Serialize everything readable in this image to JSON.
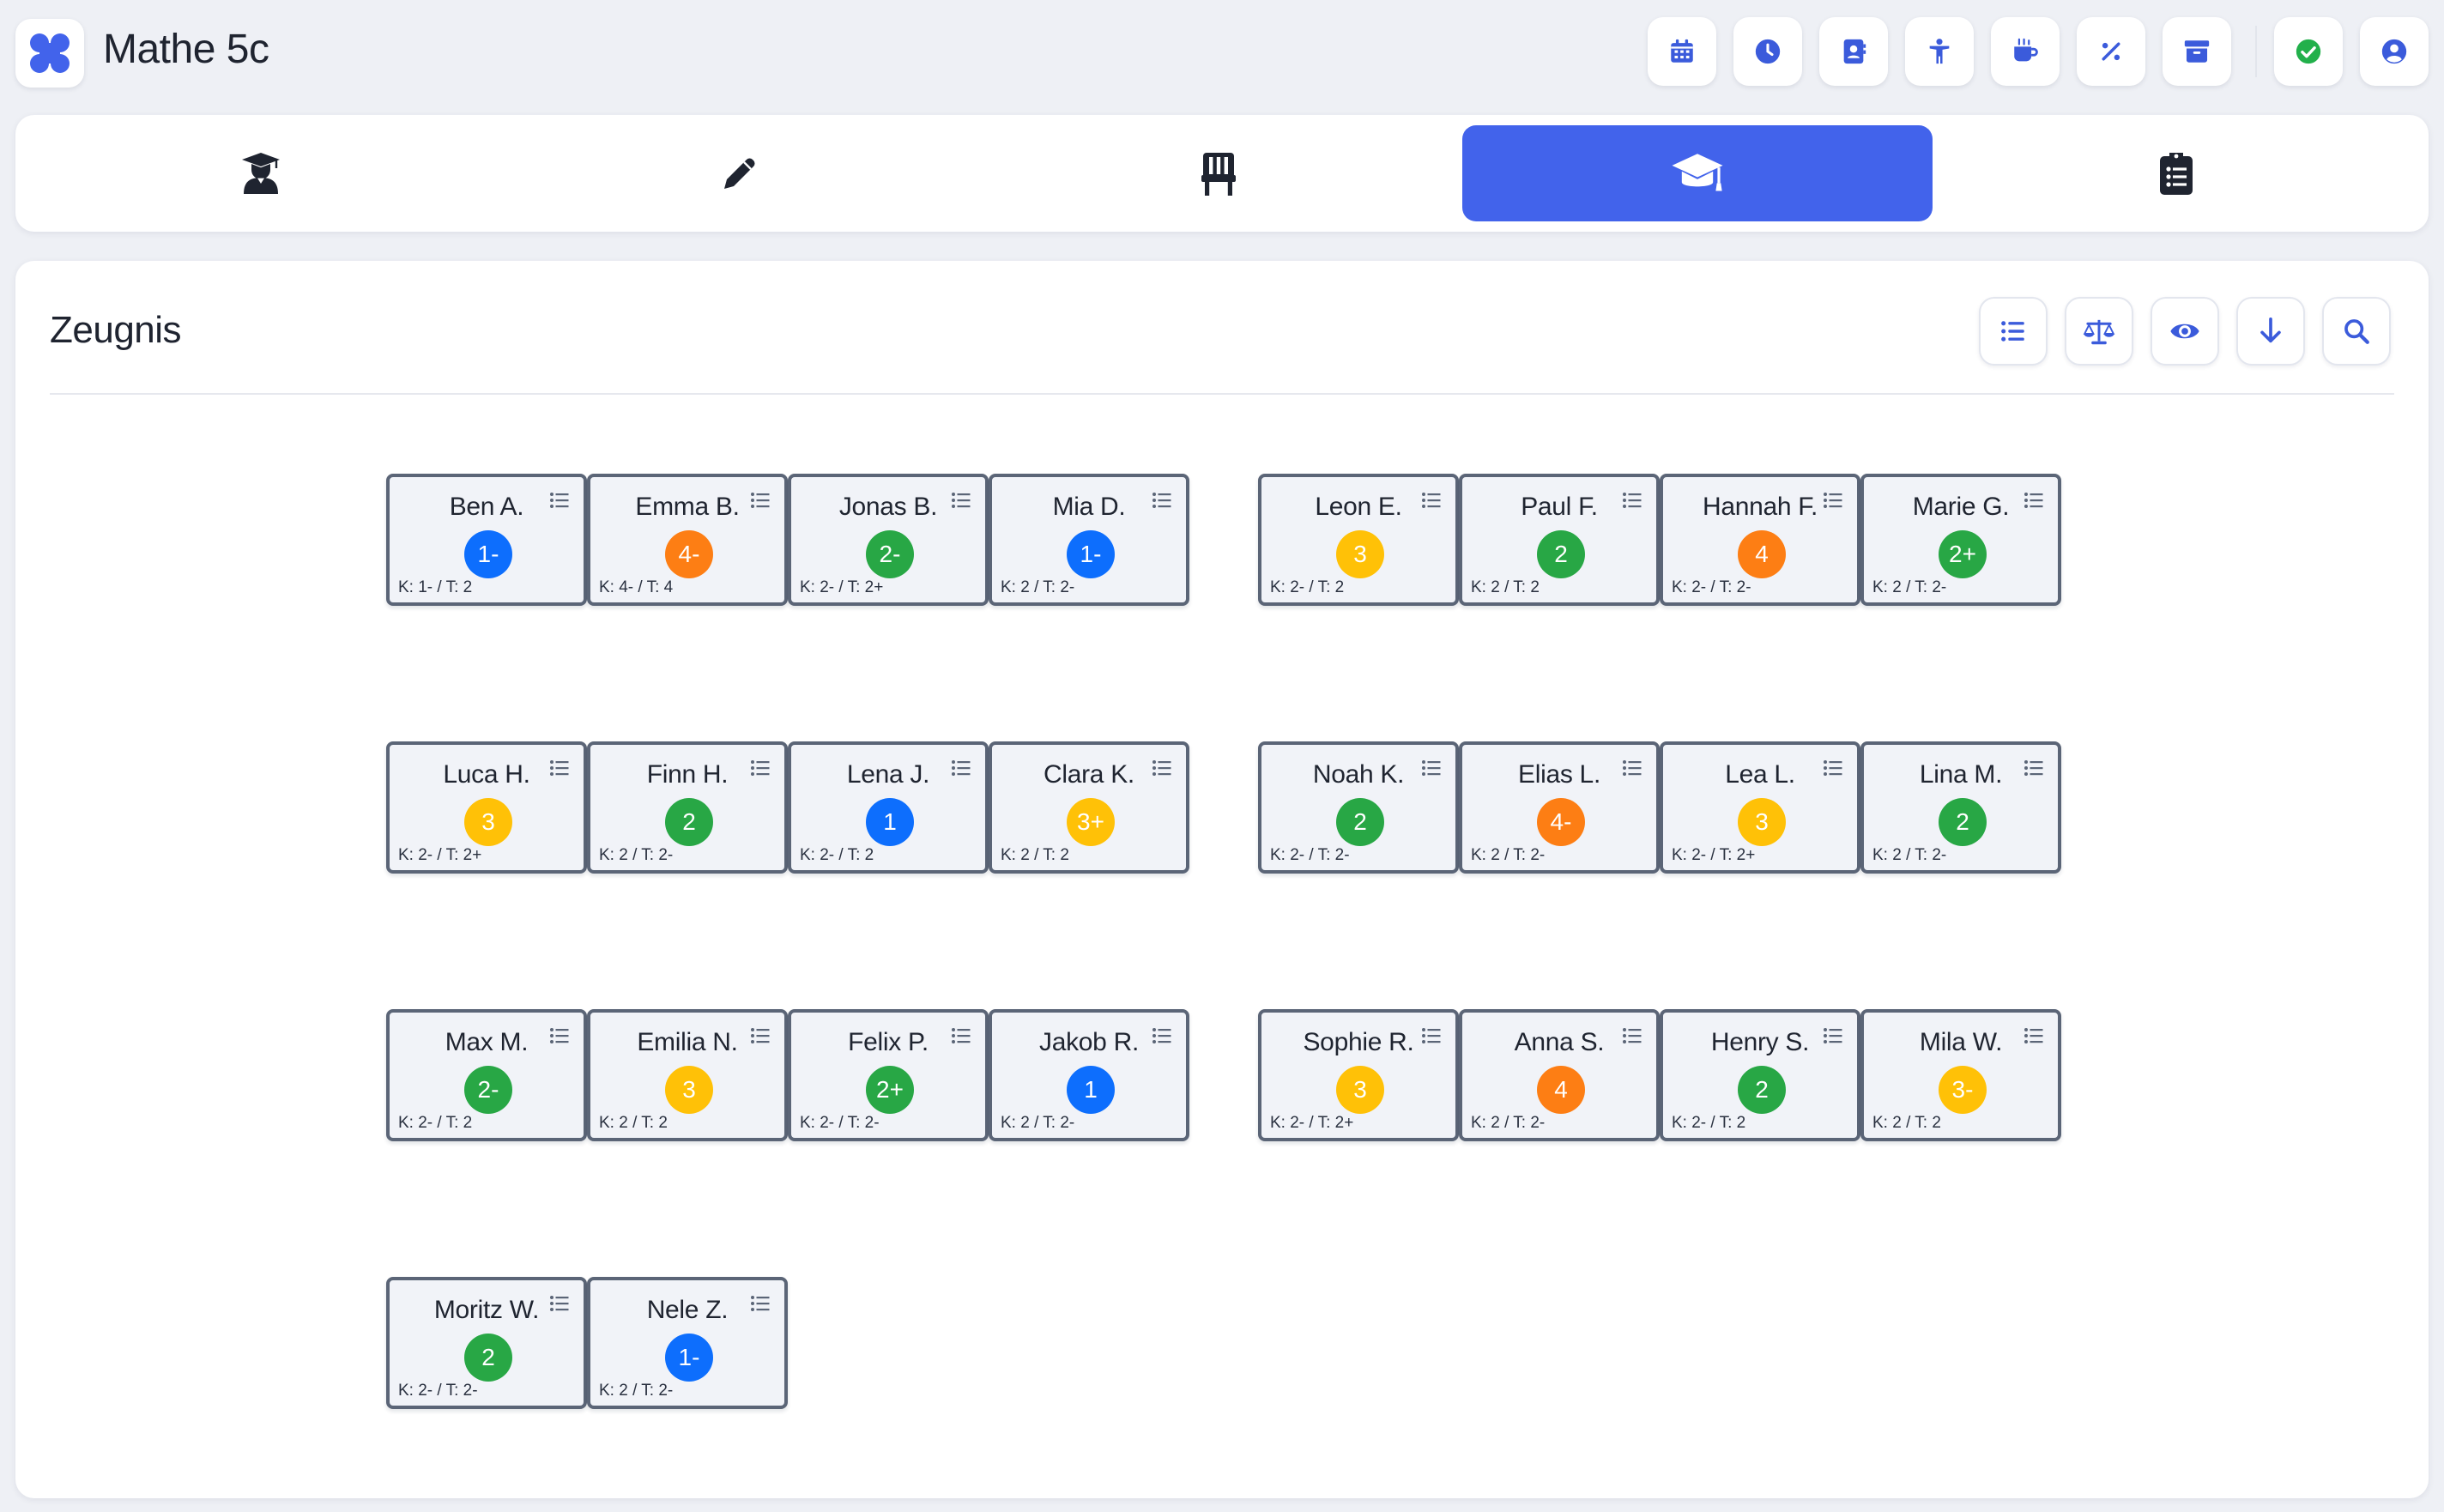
{
  "app": {
    "title": "Mathe 5c",
    "logo_icon": "app-logo-icon"
  },
  "toolbar": {
    "buttons": [
      {
        "name": "calendar-icon"
      },
      {
        "name": "clock-icon"
      },
      {
        "name": "contacts-icon"
      },
      {
        "name": "person-icon"
      },
      {
        "name": "coffee-icon"
      },
      {
        "name": "percent-icon"
      },
      {
        "name": "archive-icon"
      },
      {
        "name": "check-status-icon"
      },
      {
        "name": "user-account-icon"
      }
    ]
  },
  "tabs": [
    {
      "name": "student-teacher-icon"
    },
    {
      "name": "pencil-icon"
    },
    {
      "name": "chair-icon"
    },
    {
      "name": "graduation-cap-icon",
      "active": true
    },
    {
      "name": "clipboard-list-icon"
    }
  ],
  "panel": {
    "title": "Zeugnis",
    "actions": [
      {
        "name": "list-view-icon"
      },
      {
        "name": "balance-scale-icon"
      },
      {
        "name": "eye-icon"
      },
      {
        "name": "download-arrow-icon"
      },
      {
        "name": "search-icon"
      }
    ]
  },
  "grade_colors": {
    "blue": "#0d6efd",
    "orange": "#fd7e14",
    "green": "#28a745",
    "yellow": "#ffc107"
  },
  "students": [
    {
      "name": "Ben A.",
      "grade": "1-",
      "color": "blue",
      "detail": "K: 1- / T: 2"
    },
    {
      "name": "Emma B.",
      "grade": "4-",
      "color": "orange",
      "detail": "K: 4- / T: 4"
    },
    {
      "name": "Jonas B.",
      "grade": "2-",
      "color": "green",
      "detail": "K: 2- / T: 2+"
    },
    {
      "name": "Mia D.",
      "grade": "1-",
      "color": "blue",
      "detail": "K: 2 / T: 2-"
    },
    {
      "name": "Leon E.",
      "grade": "3",
      "color": "yellow",
      "detail": "K: 2- / T: 2"
    },
    {
      "name": "Paul F.",
      "grade": "2",
      "color": "green",
      "detail": "K: 2 / T: 2"
    },
    {
      "name": "Hannah F.",
      "grade": "4",
      "color": "orange",
      "detail": "K: 2- / T: 2-"
    },
    {
      "name": "Marie G.",
      "grade": "2+",
      "color": "green",
      "detail": "K: 2 / T: 2-"
    },
    {
      "name": "Luca H.",
      "grade": "3",
      "color": "yellow",
      "detail": "K: 2- / T: 2+"
    },
    {
      "name": "Finn H.",
      "grade": "2",
      "color": "green",
      "detail": "K: 2 / T: 2-"
    },
    {
      "name": "Lena J.",
      "grade": "1",
      "color": "blue",
      "detail": "K: 2- / T: 2"
    },
    {
      "name": "Clara K.",
      "grade": "3+",
      "color": "yellow",
      "detail": "K: 2 / T: 2"
    },
    {
      "name": "Noah K.",
      "grade": "2",
      "color": "green",
      "detail": "K: 2- / T: 2-"
    },
    {
      "name": "Elias L.",
      "grade": "4-",
      "color": "orange",
      "detail": "K: 2 / T: 2-"
    },
    {
      "name": "Lea L.",
      "grade": "3",
      "color": "yellow",
      "detail": "K: 2- / T: 2+"
    },
    {
      "name": "Lina M.",
      "grade": "2",
      "color": "green",
      "detail": "K: 2 / T: 2-"
    },
    {
      "name": "Max M.",
      "grade": "2-",
      "color": "green",
      "detail": "K: 2- / T: 2"
    },
    {
      "name": "Emilia N.",
      "grade": "3",
      "color": "yellow",
      "detail": "K: 2 / T: 2"
    },
    {
      "name": "Felix P.",
      "grade": "2+",
      "color": "green",
      "detail": "K: 2- / T: 2-"
    },
    {
      "name": "Jakob R.",
      "grade": "1",
      "color": "blue",
      "detail": "K: 2 / T: 2-"
    },
    {
      "name": "Sophie R.",
      "grade": "3",
      "color": "yellow",
      "detail": "K: 2- / T: 2+"
    },
    {
      "name": "Anna S.",
      "grade": "4",
      "color": "orange",
      "detail": "K: 2 / T: 2-"
    },
    {
      "name": "Henry S.",
      "grade": "2",
      "color": "green",
      "detail": "K: 2- / T: 2"
    },
    {
      "name": "Mila W.",
      "grade": "3-",
      "color": "yellow",
      "detail": "K: 2 / T: 2"
    },
    {
      "name": "Moritz W.",
      "grade": "2",
      "color": "green",
      "detail": "K: 2- / T: 2-"
    },
    {
      "name": "Nele Z.",
      "grade": "1-",
      "color": "blue",
      "detail": "K: 2 / T: 2-"
    }
  ]
}
